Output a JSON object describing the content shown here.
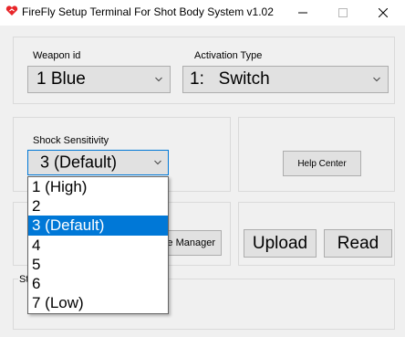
{
  "window": {
    "title": "FireFly Setup Terminal For Shot Body System v1.02",
    "controls": {
      "minimize": "–",
      "maximize": "□",
      "close": "✕"
    },
    "icon": "firefly-logo-icon"
  },
  "weapon": {
    "label": "Weapon id",
    "value": "1 Blue"
  },
  "activation": {
    "label": "Activation Type",
    "value": "1:   Switch"
  },
  "shock": {
    "label": "Shock Sensitivity",
    "value": "3 (Default)",
    "options": [
      "1 (High)",
      "2",
      "3 (Default)",
      "4",
      "5",
      "6",
      "7 (Low)"
    ],
    "selected_index": 2
  },
  "buttons": {
    "help_center": "Help Center",
    "device_manager": "ce Manager",
    "upload": "Upload",
    "read": "Read"
  },
  "status": {
    "label_partial": "St"
  },
  "colors": {
    "accent": "#0078d7",
    "window_bg": "#f0f0f0",
    "control_bg": "#e1e1e1",
    "logo_red": "#e8262a"
  }
}
